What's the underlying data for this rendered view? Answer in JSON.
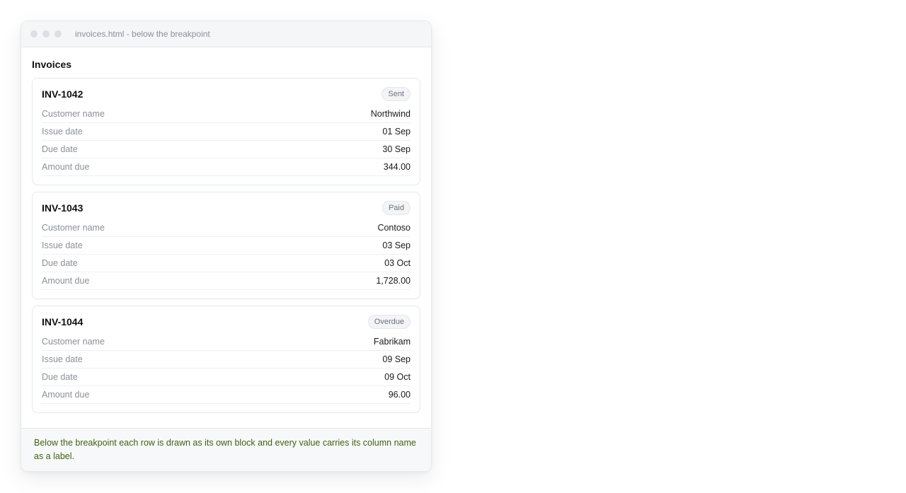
{
  "window": {
    "title": "invoices.html - below the breakpoint"
  },
  "page": {
    "heading": "Invoices"
  },
  "invoices": [
    {
      "id": "INV-1042",
      "status": "Sent",
      "rows": [
        {
          "label": "Customer name",
          "value": "Northwind"
        },
        {
          "label": "Issue date",
          "value": "01 Sep"
        },
        {
          "label": "Due date",
          "value": "30 Sep"
        },
        {
          "label": "Amount due",
          "value": "344.00"
        }
      ]
    },
    {
      "id": "INV-1043",
      "status": "Paid",
      "rows": [
        {
          "label": "Customer name",
          "value": "Contoso"
        },
        {
          "label": "Issue date",
          "value": "03 Sep"
        },
        {
          "label": "Due date",
          "value": "03 Oct"
        },
        {
          "label": "Amount due",
          "value": "1,728.00"
        }
      ]
    },
    {
      "id": "INV-1044",
      "status": "Overdue",
      "rows": [
        {
          "label": "Customer name",
          "value": "Fabrikam"
        },
        {
          "label": "Issue date",
          "value": "09 Sep"
        },
        {
          "label": "Due date",
          "value": "09 Oct"
        },
        {
          "label": "Amount due",
          "value": "96.00"
        }
      ]
    }
  ],
  "footer": {
    "note": "Below the breakpoint each row is drawn as its own block and every value carries its column name as a label."
  }
}
